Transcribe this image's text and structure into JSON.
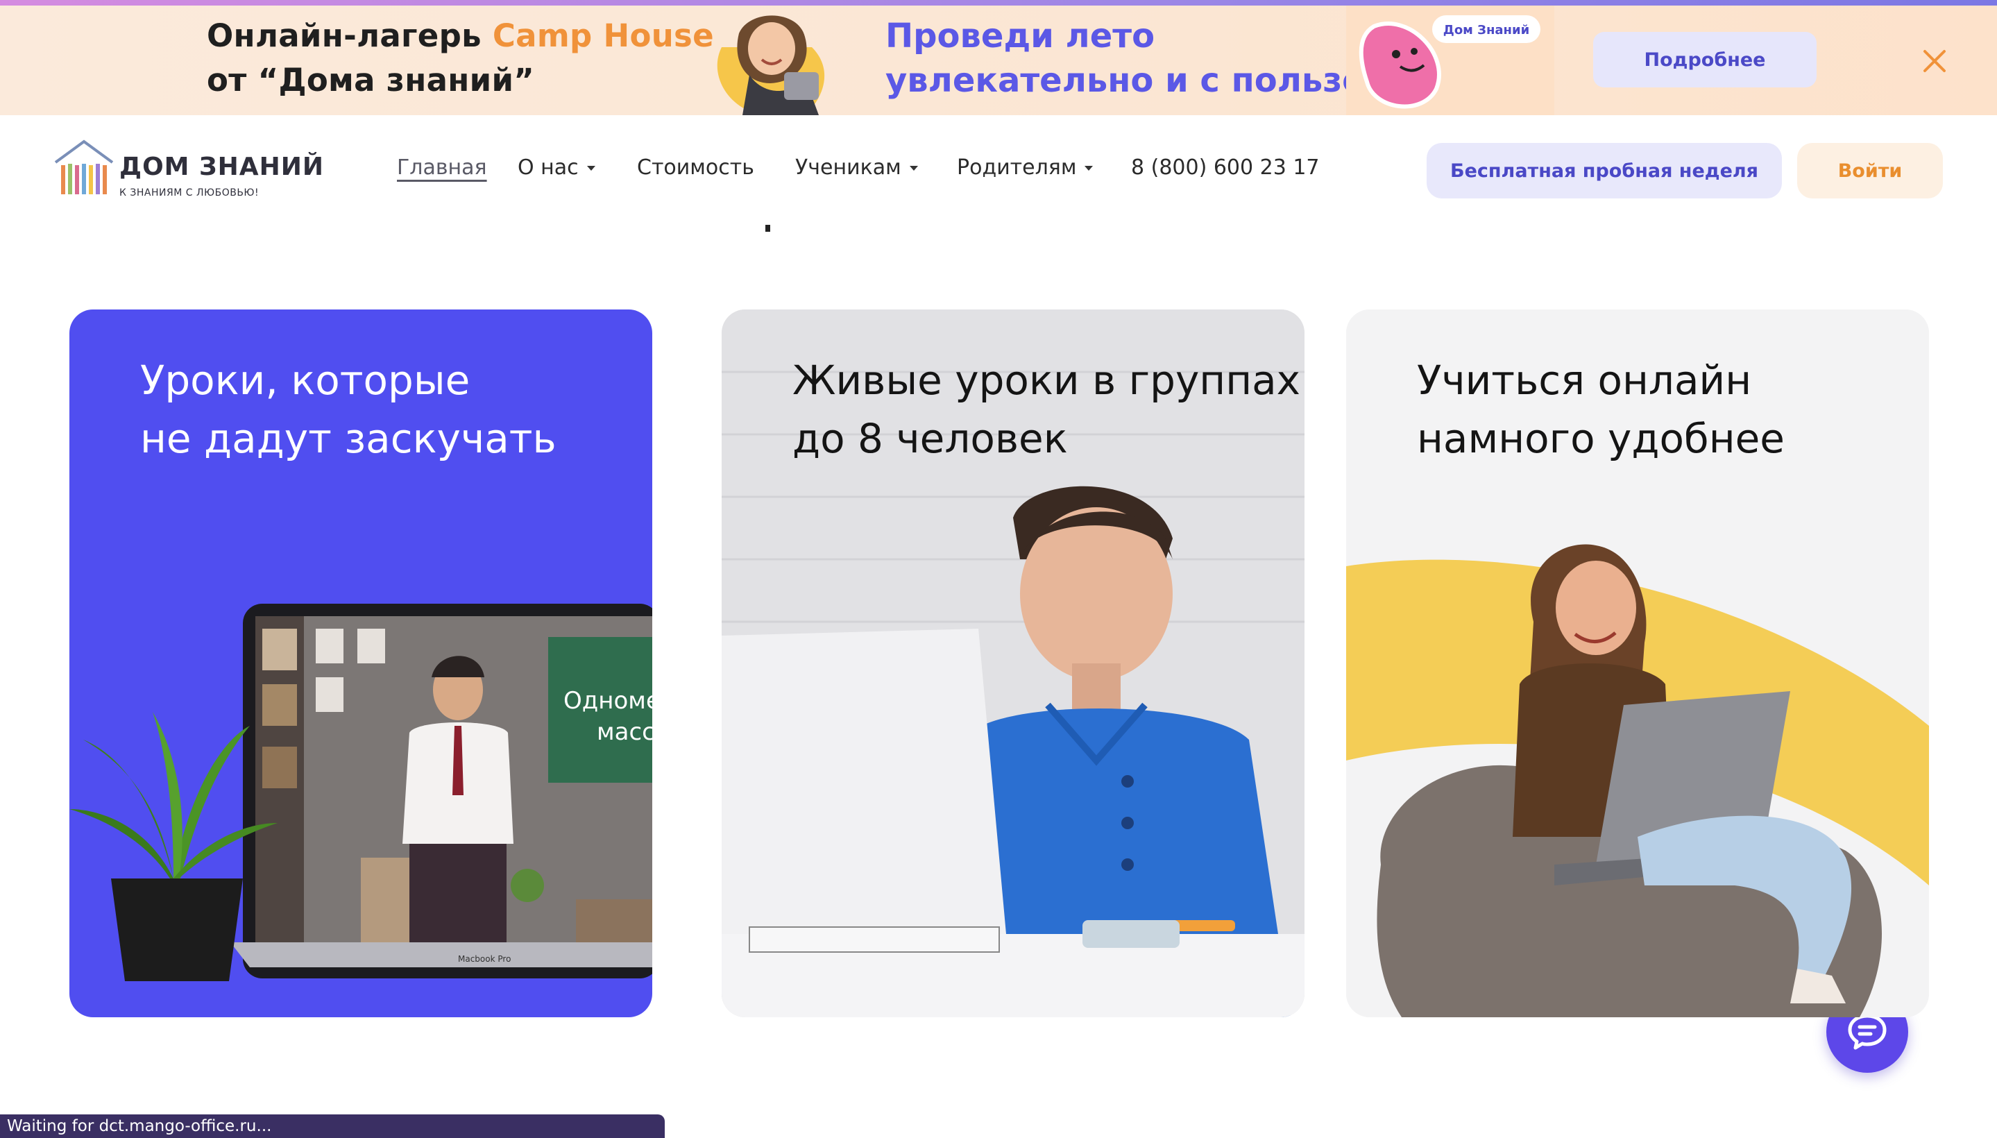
{
  "promo": {
    "title_line1_prefix": "Онлайн-лагерь ",
    "title_line1_accent": "Camp House",
    "title_line2": "от “Дома знаний”",
    "slogan_line1": "Проведи лето",
    "slogan_line2": "увлекательно и с пользой!",
    "mascot_label": "Дом Знаний",
    "more_button": "Подробнее",
    "close_icon": "close-icon"
  },
  "header": {
    "logo_word": "ДОМ ЗНАНИЙ",
    "logo_tagline": "К ЗНАНИЯМ С ЛЮБОВЬЮ!",
    "nav": [
      {
        "label": "Главная",
        "dropdown": false,
        "active": true
      },
      {
        "label": "О нас",
        "dropdown": true,
        "active": false
      },
      {
        "label": "Стоимость",
        "dropdown": false,
        "active": false
      },
      {
        "label": "Ученикам",
        "dropdown": true,
        "active": false
      },
      {
        "label": "Родителям",
        "dropdown": true,
        "active": false
      }
    ],
    "phone": "8 (800) 600 23 17",
    "trial_button": "Бесплатная пробная неделя",
    "login_button": "Войти"
  },
  "cards": [
    {
      "title": "Уроки, которые\nне дадут заскучать",
      "screen_text_line1": "Одноме",
      "screen_text_line2": "масс",
      "laptop_label": "Macbook Pro"
    },
    {
      "title": "Живые уроки в группах\nдо 8 человек"
    },
    {
      "title": "Учиться онлайн\nнамного удобнее"
    }
  ],
  "chat": {
    "icon": "chat-bubble-icon"
  },
  "status_text": "Waiting for dct.mango-office.ru...",
  "colors": {
    "brand_purple": "#504ef0",
    "accent_orange": "#f0923a",
    "slogan_blue": "#5b58e6",
    "chat_purple": "#5d47e9",
    "banner_bg": "#fbeadb"
  }
}
